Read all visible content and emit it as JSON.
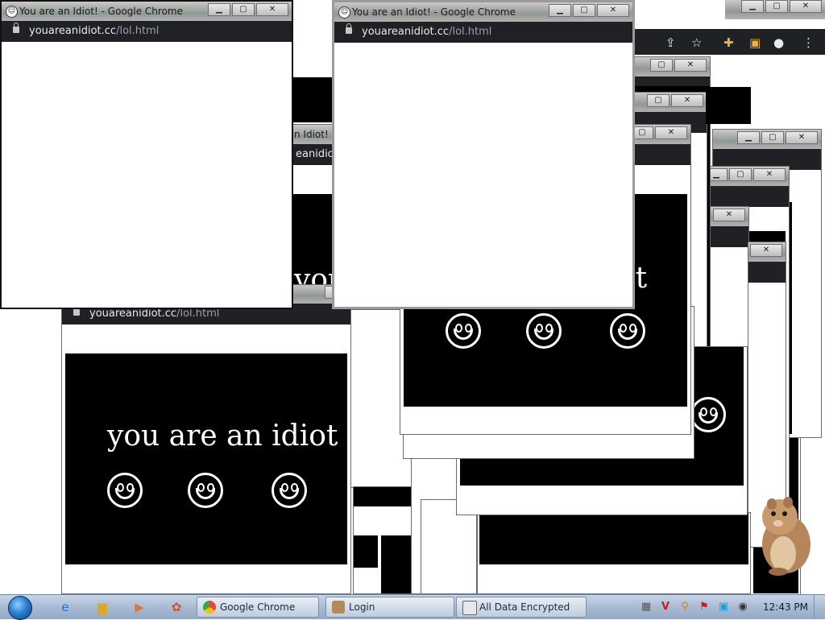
{
  "window_title": "You are an Idiot! - Google Chrome",
  "window_title_partial": "n Idiot! -",
  "url_host": "youareanidiot.cc",
  "url_path": "/lol.html",
  "url_partial": "eanidiot",
  "page_text": "you are an idiot",
  "page_text_partial_1": "you",
  "page_text_partial_2": "ot",
  "taskbar": {
    "items": [
      {
        "label": "Google Chrome"
      },
      {
        "label": "Login"
      },
      {
        "label": "All Data Encrypted"
      }
    ],
    "clock": "12:43 PM"
  },
  "icons": {
    "lock": "lock-icon",
    "share": "share-icon",
    "star": "star-icon",
    "extensions": "puzzle-icon",
    "sidepanel": "side-panel-icon",
    "profile": "profile-icon",
    "menu": "kebab-menu-icon"
  },
  "colors": {
    "stage": "#000000",
    "address_bar": "#202124",
    "taskbar": "#a9bbd3"
  }
}
